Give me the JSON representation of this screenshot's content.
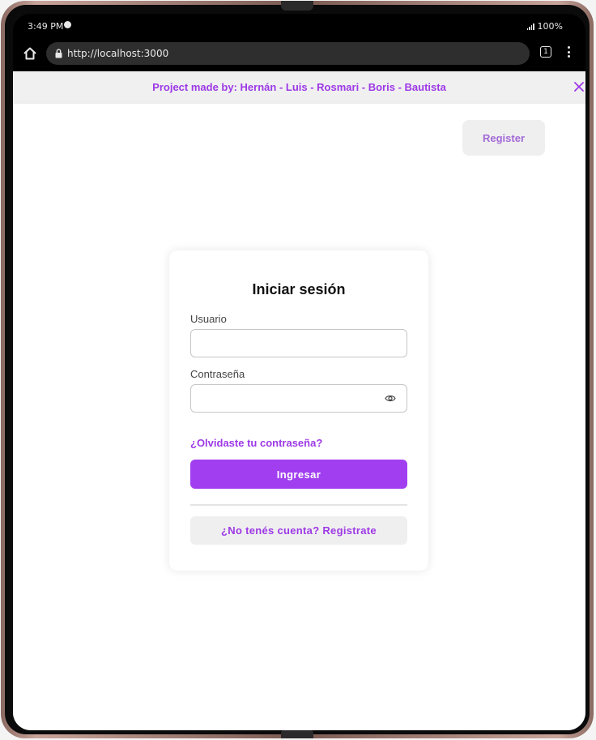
{
  "status_bar": {
    "time": "3:49 PM",
    "app_icon": "spotify-icon",
    "signal_icon": "signal-icon",
    "battery": "100%"
  },
  "browser": {
    "url": "http://localhost:3000",
    "tab_count": "1",
    "icons": [
      "home-icon",
      "lock-icon",
      "tabs-icon",
      "menu-icon"
    ]
  },
  "banner": {
    "text": "Project made by: Hernán - Luis - Rosmari - Boris - Bautista",
    "close_icon": "close-icon"
  },
  "navbar": {
    "register_label": "Register"
  },
  "login": {
    "title": "Iniciar sesión",
    "username_label": "Usuario",
    "username_value": "",
    "password_label": "Contraseña",
    "password_value": "",
    "password_toggle_icon": "eye-icon",
    "forgot_link": "¿Olvidaste tu contraseña?",
    "submit_label": "Ingresar",
    "signup_label": "¿No tenés cuenta? Registrate"
  },
  "colors": {
    "accent": "#a13ff0",
    "link": "#9d39e6",
    "banner_bg": "#f0f0f0",
    "secondary_button_bg": "#efefef"
  }
}
